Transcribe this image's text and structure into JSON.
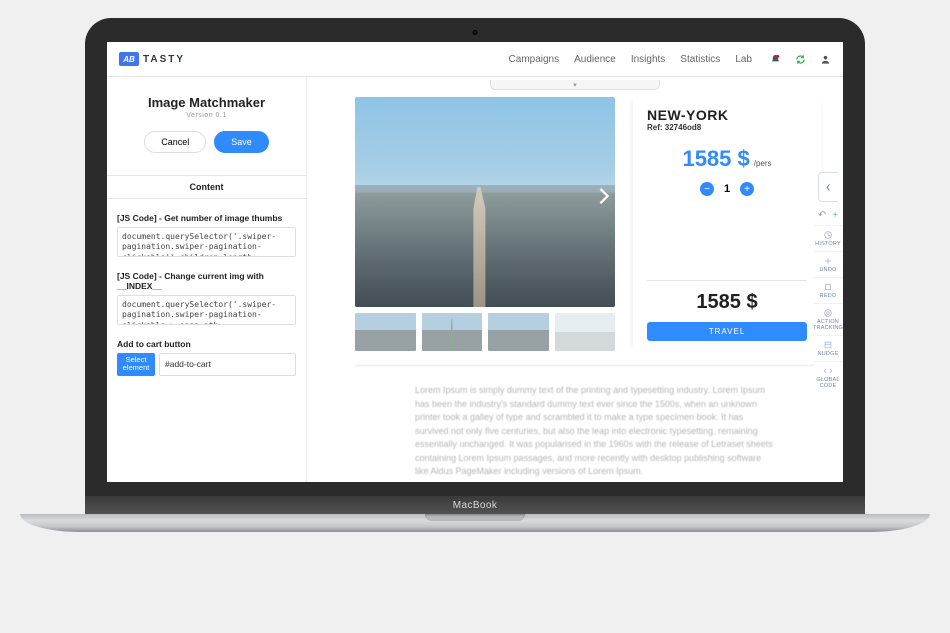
{
  "brand": {
    "mark": "AB",
    "text": "TASTY"
  },
  "nav": {
    "items": [
      "Campaigns",
      "Audience",
      "Insights",
      "Statistics",
      "Lab"
    ]
  },
  "panel": {
    "title": "Image Matchmaker",
    "version": "Version 0.1",
    "cancel_label": "Cancel",
    "save_label": "Save",
    "tab_label": "Content",
    "fields": {
      "thumbs_count_label": "[JS Code] - Get number of image thumbs",
      "thumbs_count_code": "document.querySelector('.swiper-pagination.swiper-pagination-clickable').children.length;",
      "change_img_label": "[JS Code] - Change current img with __INDEX__",
      "change_img_code": "document.querySelector('.swiper-pagination.swiper-pagination-clickable > span:nth-",
      "cart_label": "Add to cart button",
      "select_element_label": "Select element",
      "cart_selector": "#add-to-cart"
    }
  },
  "product": {
    "title": "NEW-YORK",
    "ref_label": "Ref: 32746od8",
    "price_value": "1585 $",
    "price_unit": "/pers",
    "qty": "1",
    "total": "1585 $",
    "cta": "TRAVEL"
  },
  "rail": {
    "items": [
      "HISTORY",
      "UNDO",
      "REDO",
      "ACTION TRACKING",
      "NUDGE",
      "GLOBAL CODE"
    ]
  },
  "lorem": "Lorem Ipsum is simply dummy text of the printing and typesetting industry. Lorem Ipsum has been the industry's standard dummy text ever since the 1500s, when an unknown printer took a galley of type and scrambled it to make a type specimen book. It has survived not only five centuries, but also the leap into electronic typesetting, remaining essentially unchanged. It was popularised in the 1960s with the release of Letraset sheets containing Lorem Ipsum passages, and more recently with desktop publishing software like Aldus PageMaker including versions of Lorem Ipsum.",
  "laptop_label": "MacBook",
  "topstrip_glyph": "▾"
}
